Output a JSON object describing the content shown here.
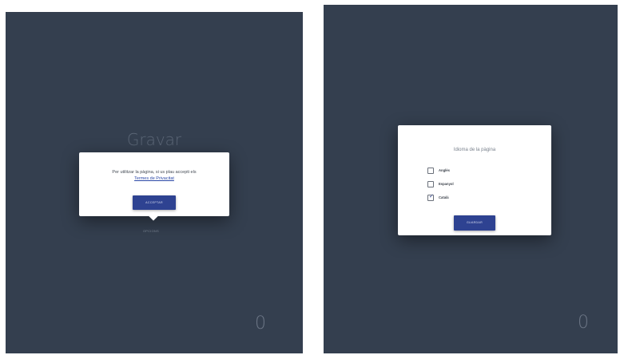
{
  "left_screen": {
    "title": "Gravar",
    "options_label": "OPCIONS",
    "counter": "0",
    "privacy_modal": {
      "text": "Per utilitzar la pàgina, si us plau accepti els",
      "link": "Termes de Privacitat",
      "accept_label": "ACCEPTAR"
    }
  },
  "right_screen": {
    "counter": "0",
    "language_modal": {
      "title": "Idioma de la pàgina",
      "languages": [
        {
          "label": "Anglès",
          "checked": false
        },
        {
          "label": "Espanyol",
          "checked": false
        },
        {
          "label": "Català",
          "checked": true
        }
      ],
      "save_label": "GUARDAR"
    }
  },
  "colors": {
    "background": "#343f4f",
    "accent": "#2e4291",
    "modal": "#ffffff"
  },
  "icons": {
    "checkmark": "check-icon"
  }
}
